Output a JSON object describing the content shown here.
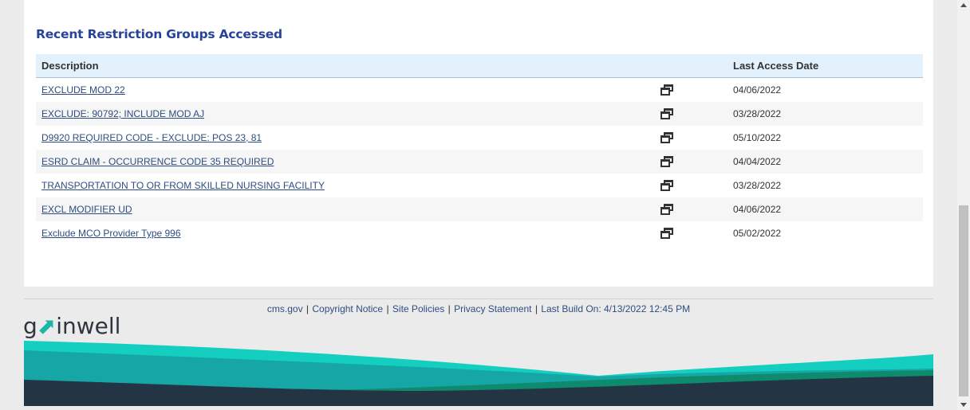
{
  "section": {
    "title": "Recent Restriction Groups Accessed"
  },
  "table": {
    "headers": {
      "description": "Description",
      "last_access": "Last Access Date"
    },
    "rows": [
      {
        "description": "EXCLUDE MOD 22",
        "date": "04/06/2022"
      },
      {
        "description": "EXCLUDE: 90792; INCLUDE MOD AJ",
        "date": "03/28/2022"
      },
      {
        "description": "D9920 REQUIRED CODE - EXCLUDE: POS 23, 81",
        "date": "05/10/2022"
      },
      {
        "description": "ESRD CLAIM - OCCURRENCE CODE 35 REQUIRED",
        "date": "04/04/2022"
      },
      {
        "description": "TRANSPORTATION TO OR FROM SKILLED NURSING FACILITY",
        "date": "03/28/2022"
      },
      {
        "description": "EXCL MODIFIER UD",
        "date": "04/06/2022"
      },
      {
        "description": "Exclude MCO Provider Type 996",
        "date": "05/02/2022"
      }
    ],
    "row_icon": "open-in-new-window-icon"
  },
  "footer": {
    "links": [
      "cms.gov",
      "Copyright Notice",
      "Site Policies",
      "Privacy Statement"
    ],
    "separator": "|",
    "build_info": "Last Build On: 4/13/2022 12:45 PM"
  },
  "logo": {
    "text": "gainwell"
  },
  "colors": {
    "title": "#27439a",
    "link": "#2d4d80",
    "header_bg": "#e2f1fc",
    "wave_teal_light": "#14cfc0",
    "wave_teal": "#16a6a6",
    "wave_green": "#0e8a6c",
    "wave_navy": "#233544"
  }
}
